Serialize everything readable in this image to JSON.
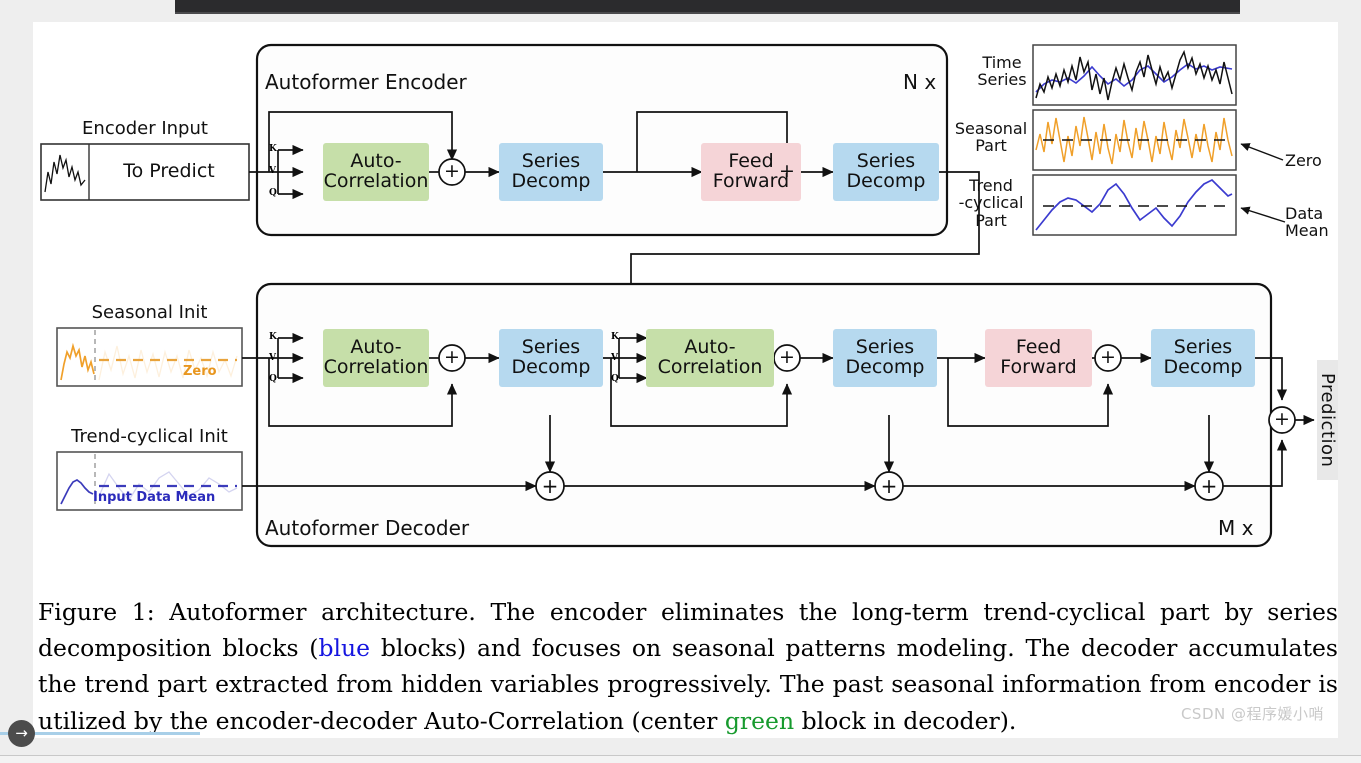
{
  "figure": {
    "encoder": {
      "title": "Autoformer Encoder",
      "repeat": "N x",
      "input_label": "Encoder Input",
      "input_text": "To Predict",
      "blocks": [
        {
          "label_line1": "Auto-",
          "label_line2": "Correlation",
          "color": "#c6dfa9",
          "kind": "auto-correlation"
        },
        {
          "label_line1": "Series",
          "label_line2": "Decomp",
          "color": "#b6d9ef",
          "kind": "series-decomp"
        },
        {
          "label_line1": "Feed",
          "label_line2": "Forward",
          "color": "#f5d4d7",
          "kind": "feed-forward"
        },
        {
          "label_line1": "Series",
          "label_line2": "Decomp",
          "color": "#b6d9ef",
          "kind": "series-decomp"
        }
      ],
      "qkv": [
        "K",
        "V",
        "Q"
      ]
    },
    "decoder": {
      "title": "Autoformer Decoder",
      "repeat": "M x",
      "seasonal_init_label": "Seasonal Init",
      "seasonal_inner_tag": "Zero",
      "trend_init_label": "Trend-cyclical Init",
      "trend_inner_tag": "Input Data Mean",
      "output_label": "Prediction",
      "blocks": [
        {
          "label_line1": "Auto-",
          "label_line2": "Correlation",
          "color": "#c6dfa9",
          "kind": "auto-correlation"
        },
        {
          "label_line1": "Series",
          "label_line2": "Decomp",
          "color": "#b6d9ef",
          "kind": "series-decomp"
        },
        {
          "label_line1": "Auto-",
          "label_line2": "Correlation",
          "color": "#c6dfa9",
          "kind": "auto-correlation-cross"
        },
        {
          "label_line1": "Series",
          "label_line2": "Decomp",
          "color": "#b6d9ef",
          "kind": "series-decomp"
        },
        {
          "label_line1": "Feed",
          "label_line2": "Forward",
          "color": "#f5d4d7",
          "kind": "feed-forward"
        },
        {
          "label_line1": "Series",
          "label_line2": "Decomp",
          "color": "#b6d9ef",
          "kind": "series-decomp"
        }
      ],
      "qkv": [
        "K",
        "V",
        "Q"
      ]
    },
    "legend": {
      "rows": [
        {
          "label": "Time\nSeries",
          "side_label": "",
          "series_color": "#000000",
          "trend_color": "#3b3bcf"
        },
        {
          "label": "Seasonal\nPart",
          "side_label": "Zero",
          "series_color": "#f0a02a",
          "trend_color": "#000000"
        },
        {
          "label": "Trend\n-cyclical\nPart",
          "side_label": "Data\nMean",
          "series_color": "#3b3bcf",
          "trend_color": "#000000"
        }
      ]
    },
    "plus_symbol": "+"
  },
  "caption": {
    "prefix": "Figure 1: Autoformer architecture. The encoder eliminates the long-term trend-cyclical part by series decomposition blocks (",
    "blue_word": "blue",
    "mid1": " blocks) and focuses on seasonal patterns modeling. The decoder accumulates the trend part extracted from hidden variables progressively. The past seasonal information from encoder is utilized by the encoder-decoder Auto-Correlation (center ",
    "green_word": "green",
    "suffix": " block in decoder)."
  },
  "watermark": "CSDN @程序媛小哨",
  "nav": {
    "next_arrow": "→"
  }
}
